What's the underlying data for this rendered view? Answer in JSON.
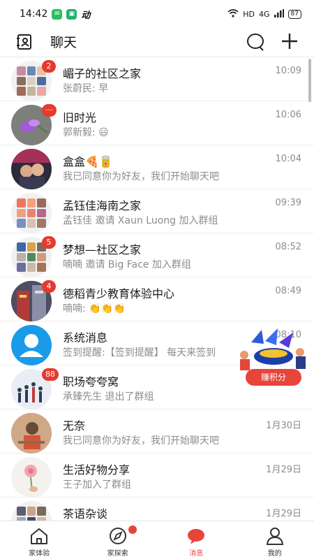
{
  "status_bar": {
    "time": "14:42",
    "app_glyph": "动",
    "network": "HD",
    "signal": "4G",
    "battery": "87"
  },
  "header": {
    "title": "聊天"
  },
  "chats": [
    {
      "name": "嵋子的社区之家",
      "message": "张蔚民: 早",
      "time": "10:09",
      "badge": "2"
    },
    {
      "name": "旧时光",
      "message": "郭新毅: 😃",
      "time": "10:06",
      "badge": "···"
    },
    {
      "name": "盒盒🍕🥫",
      "message": "我已同意你为好友，我们开始聊天吧",
      "time": "10:04",
      "badge": ""
    },
    {
      "name": "孟钰佳海南之家",
      "message": "孟钰佳 邀请 Xaun Luong 加入群组",
      "time": "09:39",
      "badge": ""
    },
    {
      "name": "梦想—社区之家",
      "message": "喃喃 邀请 Big Face 加入群组",
      "time": "08:52",
      "badge": "5"
    },
    {
      "name": "德稻青少教育体验中心",
      "message": "喃喃: 👏👏👏",
      "time": "08:49",
      "badge": "4"
    },
    {
      "name": "系统消息",
      "message": "签到提醒:【签到提醒】 每天来签到",
      "time": "08:10",
      "badge": ""
    },
    {
      "name": "职场夸夸窝",
      "message": "承臻先生 退出了群组",
      "time": "",
      "badge": "88"
    },
    {
      "name": "无奈",
      "message": "我已同意你为好友，我们开始聊天吧",
      "time": "1月30日",
      "badge": ""
    },
    {
      "name": "生活好物分享",
      "message": "王子加入了群组",
      "time": "1月29日",
      "badge": ""
    },
    {
      "name": "茶语杂谈",
      "message": "",
      "time": "1月29日",
      "badge": ""
    }
  ],
  "promo": {
    "label": "赚积分"
  },
  "nav": [
    {
      "label": "家体验"
    },
    {
      "label": "家探索"
    },
    {
      "label": "消息"
    },
    {
      "label": "我的"
    }
  ],
  "colors": {
    "accent": "#e8453a",
    "badge": "#e63a2e",
    "system_avatar": "#1a9be8"
  }
}
